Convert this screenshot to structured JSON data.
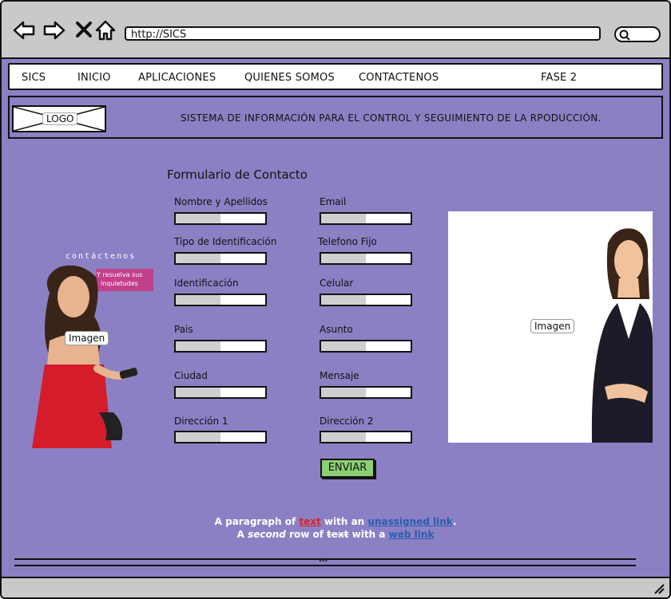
{
  "browser": {
    "url": "http://SICS",
    "icons": [
      "back-arrow-icon",
      "forward-arrow-icon",
      "close-x-icon",
      "home-icon",
      "search-icon"
    ]
  },
  "menu": {
    "items": [
      "SICS",
      "INICIO",
      "APLICACIONES",
      "QUIENES SOMOS",
      "CONTACTENOS",
      "FASE 2"
    ]
  },
  "header": {
    "logo": "LOGO",
    "slogan": "SISTEMA DE INFORMACIÓN PARA EL CONTROL Y SEGUIMIENTO DE LA RPODUCCIÓN."
  },
  "form": {
    "title": "Formulario de Contacto",
    "left_labels": [
      "Nombre y Apellidos",
      "Tipo de Identificación",
      "Identificación",
      "Pais",
      "Ciudad",
      "Dirección 1"
    ],
    "right_labels": [
      "Email",
      "Telefono Fijo",
      "Celular",
      "Asunto",
      "Mensaje",
      "Dirección 2"
    ],
    "submit": "ENVIAR"
  },
  "left_image": {
    "label": "Imagen",
    "banner_title": "contáctenos",
    "banner_sub1": "Y resuelva sus",
    "banner_sub2": "inquietudes"
  },
  "right_image": {
    "label": "Imagen"
  },
  "footer": {
    "line1_a": "A paragraph of ",
    "line1_b": "text",
    "line1_c": " with an ",
    "line1_d": "unassigned link",
    "line1_e": ".",
    "line2_a": "A ",
    "line2_b": "second",
    "line2_c": " row of ",
    "line2_d": "text",
    "line2_e": " with a ",
    "line2_f": "web link",
    "ellipsis": "..."
  },
  "colors": {
    "page_bg": "#8b80c4",
    "button": "#8ccf72",
    "link_red": "#e02020",
    "link_blue": "#2a5db0"
  }
}
